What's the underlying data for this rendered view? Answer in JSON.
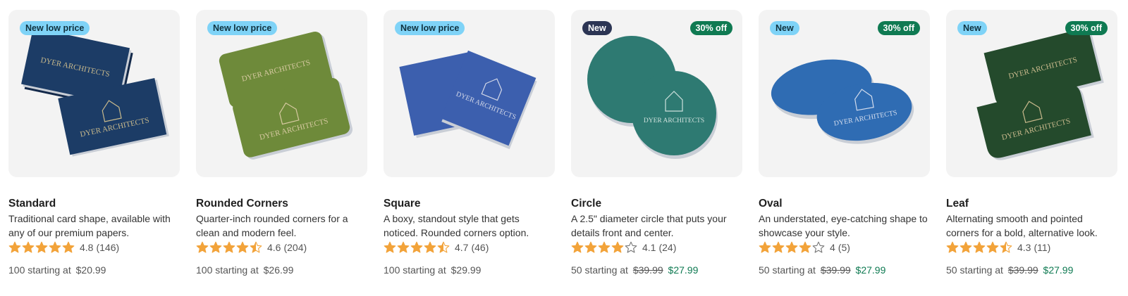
{
  "colors": {
    "sale_green": "#0f7a52",
    "star_orange": "#f2a33a",
    "badge_light": "#7fd3f7",
    "badge_dark": "#2c3554"
  },
  "card_brand_text": "DYER ARCHITECTS",
  "products": [
    {
      "name": "Standard",
      "description": "Traditional card shape, available with any of our premium papers.",
      "badge_left": "New low price",
      "badge_right": "",
      "card_color": "#1c3c66",
      "rating": 4.8,
      "rating_text": "4.8",
      "reviews": "(146)",
      "price_prefix": "100 starting at",
      "price_old": "",
      "price_current": "$20.99"
    },
    {
      "name": "Rounded Corners",
      "description": "Quarter-inch rounded corners for a clean and modern feel.",
      "badge_left": "New low price",
      "badge_right": "",
      "card_color": "#6e8a3a",
      "rating": 4.6,
      "rating_text": "4.6",
      "reviews": "(204)",
      "price_prefix": "100 starting at",
      "price_old": "",
      "price_current": "$26.99"
    },
    {
      "name": "Square",
      "description": "A boxy, standout style that gets noticed. Rounded corners option.",
      "badge_left": "New low price",
      "badge_right": "",
      "card_color": "#3c5fae",
      "rating": 4.7,
      "rating_text": "4.7",
      "reviews": "(46)",
      "price_prefix": "100 starting at",
      "price_old": "",
      "price_current": "$29.99"
    },
    {
      "name": "Circle",
      "description": "A 2.5\" diameter circle that puts your details front and center.",
      "badge_left": "New",
      "badge_left_style": "dark",
      "badge_right": "30% off",
      "card_color": "#2e7a72",
      "rating": 4.1,
      "rating_text": "4.1",
      "reviews": "(24)",
      "price_prefix": "50 starting at",
      "price_old": "$39.99",
      "price_current": "$27.99"
    },
    {
      "name": "Oval",
      "description": "An understated, eye-catching shape to showcase your style.",
      "badge_left": "New",
      "badge_right": "30% off",
      "card_color": "#2f6cb3",
      "rating": 4.0,
      "rating_text": "4",
      "reviews": "(5)",
      "price_prefix": "50 starting at",
      "price_old": "$39.99",
      "price_current": "$27.99"
    },
    {
      "name": "Leaf",
      "description": "Alternating smooth and pointed corners for a bold, alternative look.",
      "badge_left": "New",
      "badge_right": "30% off",
      "card_color": "#244a2c",
      "rating": 4.3,
      "rating_text": "4.3",
      "reviews": "(11)",
      "price_prefix": "50 starting at",
      "price_old": "$39.99",
      "price_current": "$27.99"
    }
  ]
}
